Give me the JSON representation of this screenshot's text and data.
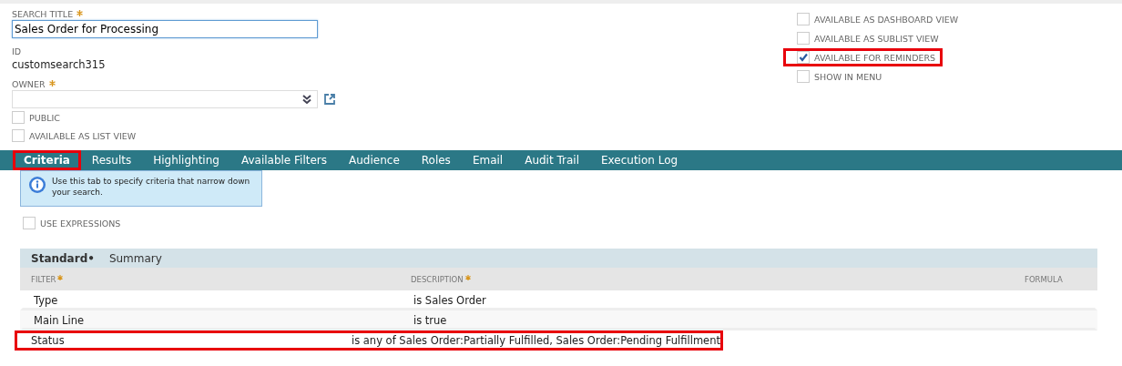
{
  "search_title": {
    "label": "SEARCH TITLE",
    "required": true,
    "value": "Sales Order for Processing"
  },
  "id_field": {
    "label": "ID",
    "value": "customsearch315"
  },
  "owner": {
    "label": "OWNER",
    "required": true
  },
  "left_options": [
    {
      "label": "PUBLIC",
      "checked": false
    },
    {
      "label": "AVAILABLE AS LIST VIEW",
      "checked": false
    }
  ],
  "right_options": [
    {
      "label": "AVAILABLE AS DASHBOARD VIEW",
      "checked": false,
      "highlighted": false
    },
    {
      "label": "AVAILABLE AS SUBLIST VIEW",
      "checked": false,
      "highlighted": false
    },
    {
      "label": "AVAILABLE FOR REMINDERS",
      "checked": true,
      "highlighted": true
    },
    {
      "label": "SHOW IN MENU",
      "checked": false,
      "highlighted": false
    }
  ],
  "tabs": [
    {
      "label": "Criteria",
      "selected": true,
      "highlighted": true
    },
    {
      "label": "Results",
      "selected": false,
      "highlighted": false
    },
    {
      "label": "Highlighting",
      "selected": false,
      "highlighted": false
    },
    {
      "label": "Available Filters",
      "selected": false,
      "highlighted": false
    },
    {
      "label": "Audience",
      "selected": false,
      "highlighted": false
    },
    {
      "label": "Roles",
      "selected": false,
      "highlighted": false
    },
    {
      "label": "Email",
      "selected": false,
      "highlighted": false
    },
    {
      "label": "Audit Trail",
      "selected": false,
      "highlighted": false
    },
    {
      "label": "Execution Log",
      "selected": false,
      "highlighted": false
    }
  ],
  "info": "Use this tab to specify criteria that narrow down your search.",
  "use_expressions": {
    "label": "USE EXPRESSIONS",
    "checked": false
  },
  "subtabs": [
    {
      "label": "Standard",
      "selected": true,
      "marker": "•"
    },
    {
      "label": "Summary",
      "selected": false
    }
  ],
  "table": {
    "columns": [
      {
        "label": "FILTER",
        "required": true
      },
      {
        "label": "DESCRIPTION",
        "required": true
      },
      {
        "label": "FORMULA",
        "required": false
      }
    ],
    "rows": [
      {
        "filter": "Type",
        "description": "is Sales Order",
        "highlighted": false
      },
      {
        "filter": "Main Line",
        "description": "is true",
        "highlighted": false
      },
      {
        "filter": "Status",
        "description": "is any of Sales Order:Partially Fulfilled, Sales Order:Pending Fulfillment",
        "highlighted": true
      }
    ]
  }
}
